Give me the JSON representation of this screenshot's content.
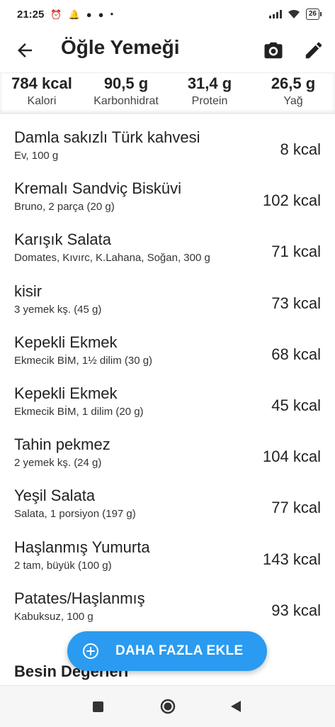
{
  "status_bar": {
    "time": "21:25",
    "icons": [
      "alarm-off-icon",
      "bell-icon",
      "app-icon",
      "app-icon"
    ],
    "battery": "26"
  },
  "header": {
    "title": "Öğle Yemeği",
    "back_icon": "arrow-left-icon",
    "camera_icon": "camera-icon",
    "edit_icon": "pencil-icon"
  },
  "summary": [
    {
      "value": "784 kcal",
      "label": "Kalori"
    },
    {
      "value": "90,5 g",
      "label": "Karbonhidrat"
    },
    {
      "value": "31,4 g",
      "label": "Protein"
    },
    {
      "value": "26,5 g",
      "label": "Yağ"
    }
  ],
  "foods": [
    {
      "name": "Damla sakızlı Türk kahvesi",
      "detail": "Ev, 100 g",
      "kcal": "8 kcal"
    },
    {
      "name": "Kremalı Sandviç Bisküvi",
      "detail": "Bruno, 2 parça (20 g)",
      "kcal": "102 kcal"
    },
    {
      "name": "Karışık Salata",
      "detail": "Domates, Kıvırc, K.Lahana, Soğan, 300 g",
      "kcal": "71 kcal"
    },
    {
      "name": "kisir",
      "detail": "3 yemek kş. (45 g)",
      "kcal": "73 kcal"
    },
    {
      "name": "Kepekli Ekmek",
      "detail": "Ekmecik BİM, 1½ dilim (30 g)",
      "kcal": "68 kcal"
    },
    {
      "name": "Kepekli Ekmek",
      "detail": "Ekmecik BİM, 1 dilim (20 g)",
      "kcal": "45 kcal"
    },
    {
      "name": "Tahin pekmez",
      "detail": "2 yemek kş. (24 g)",
      "kcal": "104 kcal"
    },
    {
      "name": "Yeşil Salata",
      "detail": "Salata, 1 porsiyon (197 g)",
      "kcal": "77 kcal"
    },
    {
      "name": "Haşlanmış Yumurta",
      "detail": "2 tam, büyük (100 g)",
      "kcal": "143 kcal"
    },
    {
      "name": "Patates/Haşlanmış",
      "detail": "Kabuksuz, 100 g",
      "kcal": "93 kcal"
    }
  ],
  "section_heading": "Besin Değerleri",
  "fab": {
    "label": "DAHA FAZLA EKLE",
    "icon": "plus-circle-icon"
  },
  "colors": {
    "accent": "#2a9bf0",
    "text": "#222222"
  },
  "nav": {
    "recents_icon": "square-icon",
    "home_icon": "circle-icon",
    "back_icon": "triangle-back-icon"
  }
}
